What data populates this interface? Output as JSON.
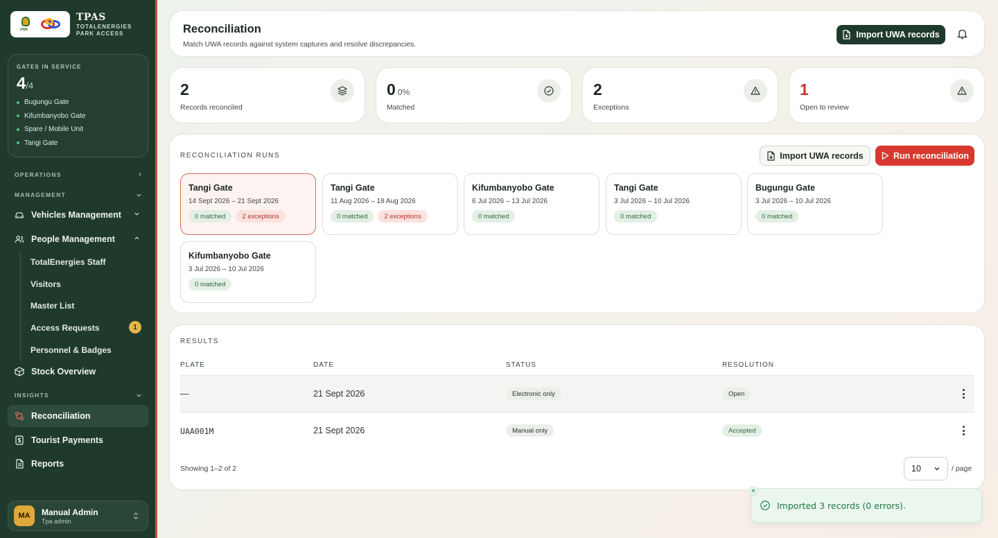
{
  "brand": {
    "name": "TPAS",
    "subtitle_line1": "TOTALENERGIES",
    "subtitle_line2": "PARK ACCESS",
    "uwa_text": "UWA"
  },
  "gates": {
    "label": "GATES IN SERVICE",
    "count": "4",
    "total": "/4",
    "items": [
      "Bugungu Gate",
      "Kifumbanyobo Gate",
      "Spare / Mobile Unit",
      "Tangi Gate"
    ]
  },
  "nav": {
    "operations": "OPERATIONS",
    "management": "MANAGEMENT",
    "insights": "INSIGHTS",
    "vehicles": "Vehicles Management",
    "people": "People Management",
    "people_sub": [
      "TotalEnergies Staff",
      "Visitors",
      "Master List",
      "Access Requests",
      "Personnel & Badges"
    ],
    "access_requests_badge": "1",
    "stock": "Stock Overview",
    "reconciliation": "Reconciliation",
    "tourist_payments": "Tourist Payments",
    "reports": "Reports"
  },
  "user": {
    "initials": "MA",
    "name": "Manual Admin",
    "role": "Tpa admin"
  },
  "header": {
    "title": "Reconciliation",
    "subtitle": "Match UWA records against system captures and resolve discrepancies.",
    "import_button": "Import UWA records"
  },
  "stats": [
    {
      "value": "2",
      "pct": "",
      "label": "Records reconciled",
      "icon": "layers-icon",
      "red": false
    },
    {
      "value": "0",
      "pct": "0%",
      "label": "Matched",
      "icon": "check-circle-icon",
      "red": false
    },
    {
      "value": "2",
      "pct": "",
      "label": "Exceptions",
      "icon": "warning-icon",
      "red": false
    },
    {
      "value": "1",
      "pct": "",
      "label": "Open to review",
      "icon": "warning-icon",
      "red": true
    }
  ],
  "runs": {
    "label": "RECONCILIATION RUNS",
    "import_button": "Import UWA records",
    "run_button": "Run reconciliation",
    "items": [
      {
        "gate": "Tangi Gate",
        "dates": "14 Sept 2026 – 21 Sept 2026",
        "matched": "0 matched",
        "exceptions": "2 exceptions"
      },
      {
        "gate": "Tangi Gate",
        "dates": "11 Aug 2026 – 18 Aug 2026",
        "matched": "0 matched",
        "exceptions": "2 exceptions"
      },
      {
        "gate": "Kifumbanyobo Gate",
        "dates": "6 Jul 2026 – 13 Jul 2026",
        "matched": "0 matched",
        "exceptions": ""
      },
      {
        "gate": "Tangi Gate",
        "dates": "3 Jul 2026 – 10 Jul 2026",
        "matched": "0 matched",
        "exceptions": ""
      },
      {
        "gate": "Bugungu Gate",
        "dates": "3 Jul 2026 – 10 Jul 2026",
        "matched": "0 matched",
        "exceptions": ""
      },
      {
        "gate": "Kifumbanyobo Gate",
        "dates": "3 Jul 2026 – 10 Jul 2026",
        "matched": "0 matched",
        "exceptions": ""
      }
    ]
  },
  "results": {
    "label": "RESULTS",
    "columns": [
      "PLATE",
      "DATE",
      "STATUS",
      "RESOLUTION"
    ],
    "rows": [
      {
        "plate": "—",
        "date": "21 Sept 2026",
        "status": "Electronic only",
        "resolution": "Open"
      },
      {
        "plate": "UAA001M",
        "date": "21 Sept 2026",
        "status": "Manual only",
        "resolution": "Accepted"
      }
    ],
    "showing": "Showing 1–2 of 2",
    "page_size": "10",
    "per_page": "/ page"
  },
  "toast": {
    "message": "Imported 3 records (0 errors)."
  },
  "colors": {
    "sidebar": "#1f3a2c",
    "accent_red": "#d7392e",
    "success": "#1f7a44"
  }
}
